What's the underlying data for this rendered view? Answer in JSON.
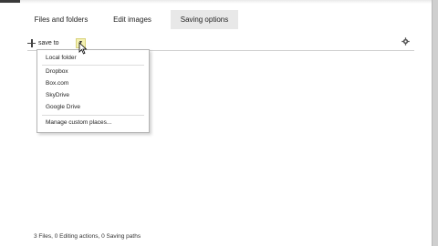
{
  "tabs": [
    {
      "label": "Files and folders",
      "active": false
    },
    {
      "label": "Edit images",
      "active": false
    },
    {
      "label": "Saving options",
      "active": true
    }
  ],
  "toolbar": {
    "save_to_label": "save to",
    "dropdown_icon": "chevron-down-icon",
    "settings_icon": "gear-icon"
  },
  "save_menu": {
    "items": [
      {
        "label": "Local folder"
      },
      {
        "label": "Dropbox"
      },
      {
        "label": "Box.com"
      },
      {
        "label": "SkyDrive"
      },
      {
        "label": "Google Drive"
      },
      {
        "label": "Manage custom places..."
      }
    ]
  },
  "status_bar": {
    "text": "3 Files, 0 Editing actions, 0 Saving paths"
  },
  "colors": {
    "active_tab_bg": "#e8e8e8",
    "dropdown_highlight": "#f4f1b3",
    "menu_border": "#b4b4b4"
  }
}
